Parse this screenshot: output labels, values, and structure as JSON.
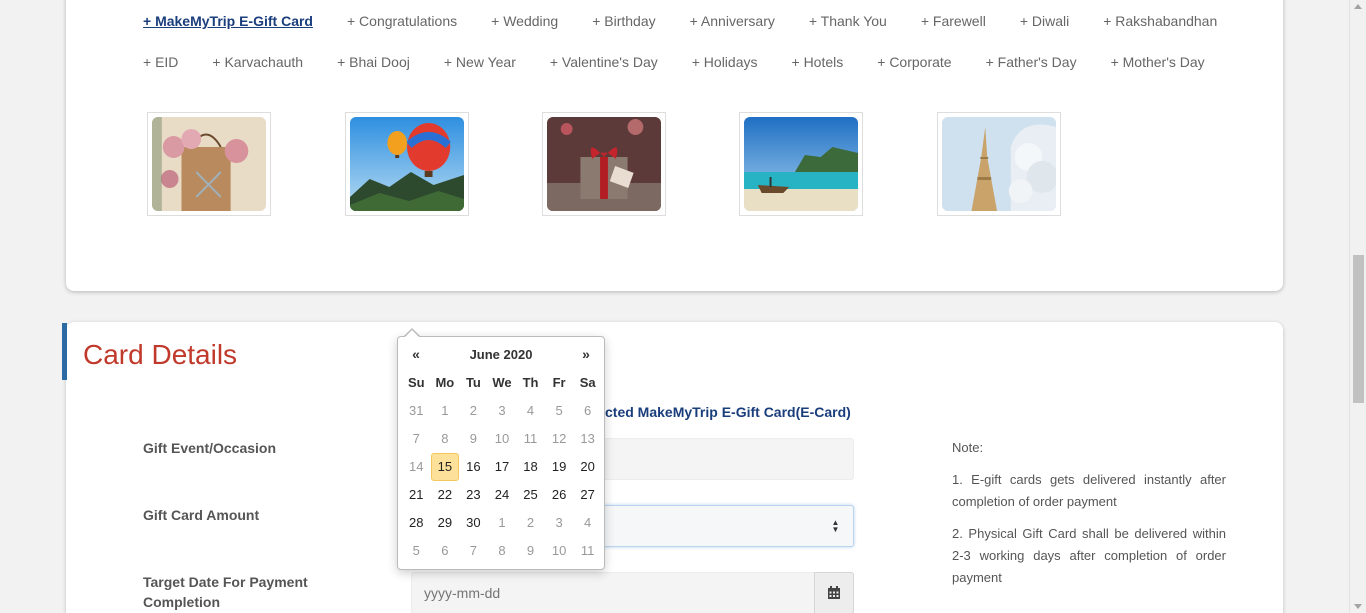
{
  "occasions": {
    "row1": [
      "+ MakeMyTrip E-Gift Card",
      "+ Congratulations",
      "+ Wedding",
      "+ Birthday",
      "+ Anniversary",
      "+ Thank You",
      "+ Farewell",
      "+ Diwali",
      "+ Rakshabandhan"
    ],
    "row2": [
      "+ EID",
      "+ Karvachauth",
      "+ Bhai Dooj",
      "+ New Year",
      "+ Valentine's Day",
      "+ Holidays",
      "+ Hotels",
      "+ Corporate",
      "+ Father's Day",
      "+ Mother's Day"
    ],
    "active": "+ MakeMyTrip E-Gift Card"
  },
  "thumbnails": [
    "roses-gift-bag",
    "hot-air-balloons",
    "red-ribbon-gift",
    "tropical-beach-boat",
    "eiffel-tower-winter"
  ],
  "card_details": {
    "title": "Card Details",
    "card_type_text": "cted MakeMyTrip E-Gift Card(E-Card)",
    "labels": {
      "event": "Gift Event/Occasion",
      "amount": "Gift Card Amount",
      "target_date": "Target Date For Payment Completion"
    },
    "date_placeholder": "yyyy-mm-dd",
    "note": {
      "heading": "Note:",
      "item1": "1. E-gift cards gets delivered instantly after completion of order payment",
      "item2": "2. Physical Gift Card shall be delivered within 2-3 working days after completion of order payment"
    }
  },
  "datepicker": {
    "prev": "«",
    "next": "»",
    "title": "June 2020",
    "dow": [
      "Su",
      "Mo",
      "Tu",
      "We",
      "Th",
      "Fr",
      "Sa"
    ],
    "weeks": [
      [
        {
          "d": "31",
          "old": true
        },
        {
          "d": "1",
          "old": true
        },
        {
          "d": "2",
          "old": true
        },
        {
          "d": "3",
          "old": true
        },
        {
          "d": "4",
          "old": true
        },
        {
          "d": "5",
          "old": true
        },
        {
          "d": "6",
          "old": true
        }
      ],
      [
        {
          "d": "7",
          "old": true
        },
        {
          "d": "8",
          "old": true
        },
        {
          "d": "9",
          "old": true
        },
        {
          "d": "10",
          "old": true
        },
        {
          "d": "11",
          "old": true
        },
        {
          "d": "12",
          "old": true
        },
        {
          "d": "13",
          "old": true
        }
      ],
      [
        {
          "d": "14",
          "old": true
        },
        {
          "d": "15",
          "today": true
        },
        {
          "d": "16"
        },
        {
          "d": "17"
        },
        {
          "d": "18"
        },
        {
          "d": "19"
        },
        {
          "d": "20"
        }
      ],
      [
        {
          "d": "21"
        },
        {
          "d": "22"
        },
        {
          "d": "23"
        },
        {
          "d": "24"
        },
        {
          "d": "25"
        },
        {
          "d": "26"
        },
        {
          "d": "27"
        }
      ],
      [
        {
          "d": "28"
        },
        {
          "d": "29"
        },
        {
          "d": "30"
        },
        {
          "d": "1",
          "old": true
        },
        {
          "d": "2",
          "old": true
        },
        {
          "d": "3",
          "old": true
        },
        {
          "d": "4",
          "old": true
        }
      ],
      [
        {
          "d": "5",
          "old": true
        },
        {
          "d": "6",
          "old": true
        },
        {
          "d": "7",
          "old": true
        },
        {
          "d": "8",
          "old": true
        },
        {
          "d": "9",
          "old": true
        },
        {
          "d": "10",
          "old": true
        },
        {
          "d": "11",
          "old": true
        }
      ]
    ]
  },
  "colors": {
    "accent": "#2b6aa3",
    "title_red": "#c0392b",
    "link_blue": "#1a3d7c",
    "today_bg": "#fde19a"
  }
}
